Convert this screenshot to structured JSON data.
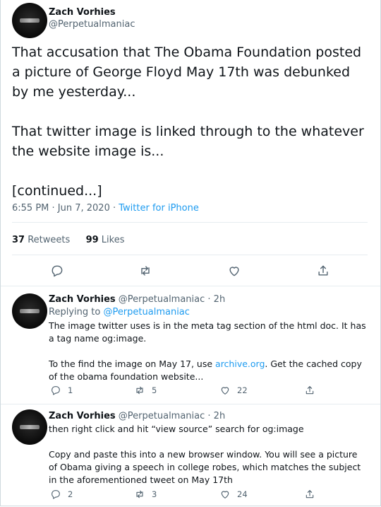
{
  "main_tweet": {
    "author_name": "Zach Vorhies",
    "author_handle": "@Perpetualmaniac",
    "paragraphs": [
      "That accusation that The Obama Foundation posted a picture of George Floyd May 17th was debunked by me yesterday...",
      "That twitter image is linked through to the whatever the website image is...",
      "[continued...]"
    ],
    "time": "6:55 PM · Jun 7, 2020 · ",
    "source": "Twitter for iPhone",
    "retweet_count": "37",
    "retweet_label": "Retweets",
    "like_count": "99",
    "like_label": "Likes"
  },
  "replies": [
    {
      "author_name": "Zach Vorhies",
      "author_handle": "@Perpetualmaniac · 2h",
      "replying_label": "Replying to ",
      "replying_to": "@Perpetualmaniac",
      "p1": "The image twitter uses is in the meta tag section of the html doc. It has a tag name og:image.",
      "p2_before": "To the find the image on May 17, use ",
      "p2_link": "archive.org",
      "p2_after": ". Get the cached copy of the obama foundation website...",
      "reply_count": "1",
      "retweet_count": "5",
      "like_count": "22"
    },
    {
      "author_name": "Zach Vorhies",
      "author_handle": "@Perpetualmaniac · 2h",
      "p1": "then right click and hit “view source” search for og:image",
      "p2": "Copy and paste this into a new browser window. You will see a picture of Obama giving a speech in college robes, which matches the subject in the aforementioned tweet on May 17th",
      "reply_count": "2",
      "retweet_count": "3",
      "like_count": "24"
    }
  ],
  "icons": {
    "reply": "speech-bubble-icon",
    "retweet": "retweet-icon",
    "like": "heart-icon",
    "share": "share-icon"
  },
  "colors": {
    "accent": "#1d9bf0",
    "secondary_text": "#536471",
    "divider": "#e6ecf0"
  }
}
